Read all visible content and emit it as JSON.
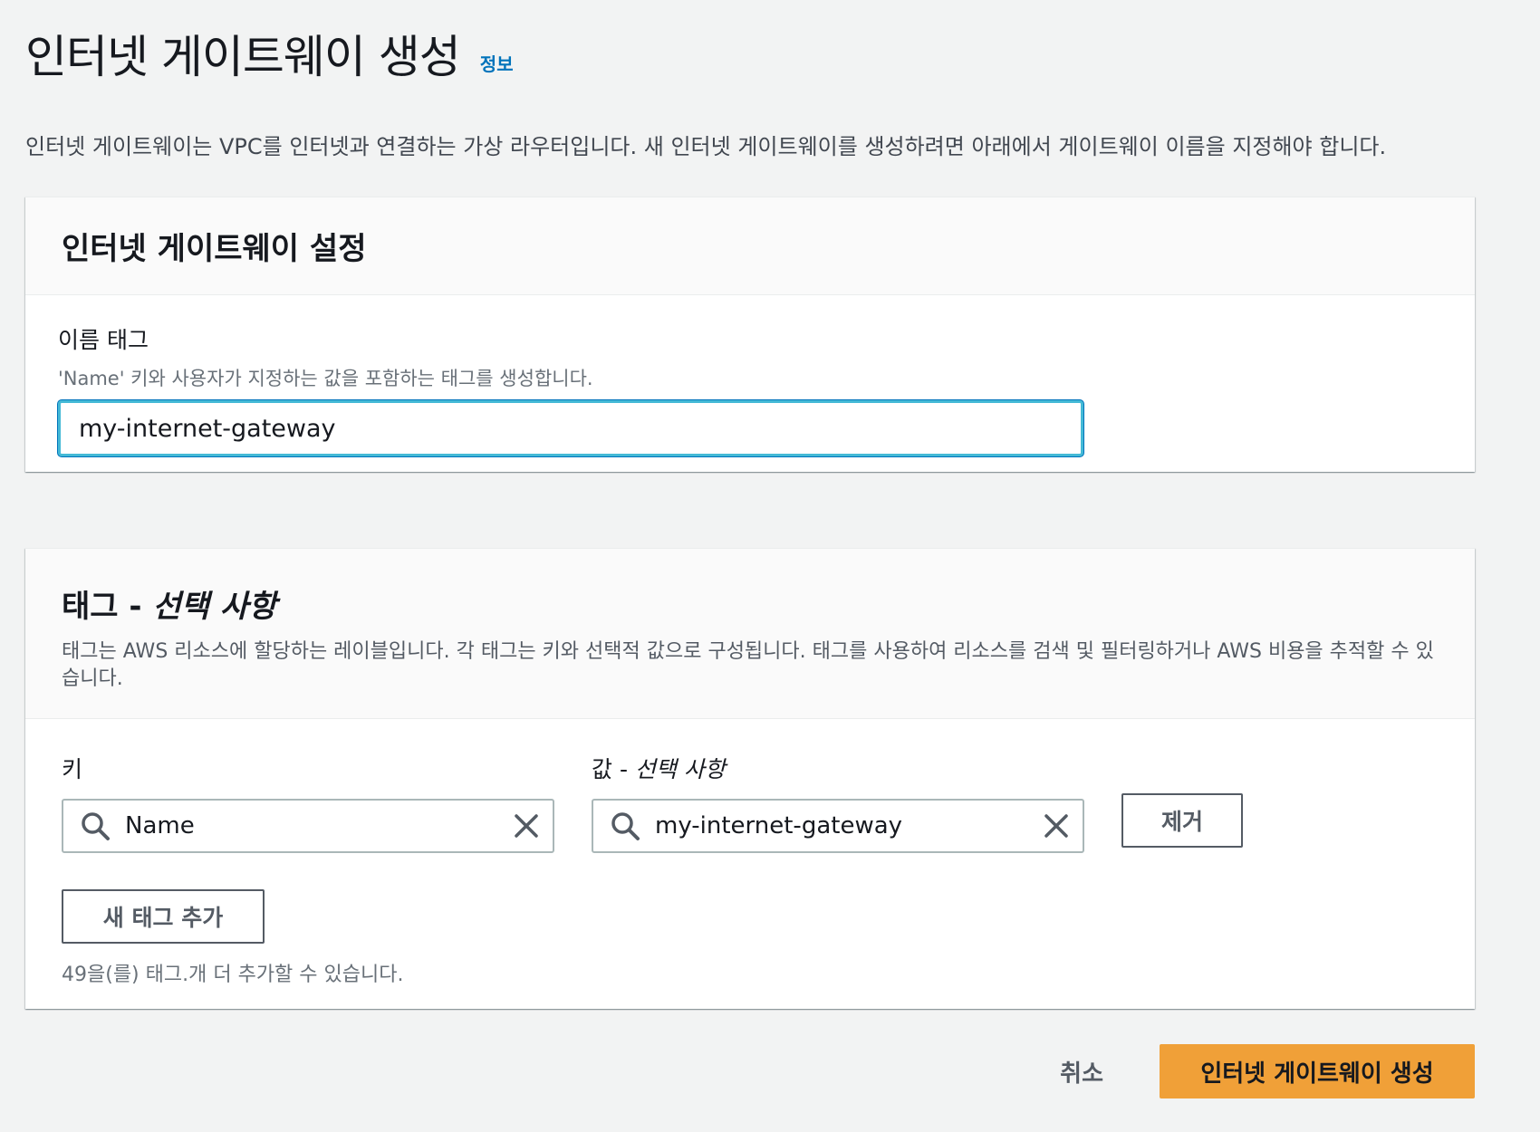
{
  "header": {
    "title": "인터넷 게이트웨이 생성",
    "info_link": "정보",
    "description": "인터넷 게이트웨이는 VPC를 인터넷과 연결하는 가상 라우터입니다. 새 인터넷 게이트웨이를 생성하려면 아래에서 게이트웨이 이름을 지정해야 합니다."
  },
  "settings": {
    "title": "인터넷 게이트웨이 설정",
    "name_tag_label": "이름 태그",
    "name_tag_description": "'Name' 키와 사용자가 지정하는 값을 포함하는 태그를 생성합니다.",
    "name_tag_value": "my-internet-gateway"
  },
  "tags": {
    "title_main": "태그 - ",
    "title_optional": "선택 사항",
    "description": "태그는 AWS 리소스에 할당하는 레이블입니다. 각 태그는 키와 선택적 값으로 구성됩니다. 태그를 사용하여 리소스를 검색 및 필터링하거나 AWS 비용을 추적할 수 있습니다.",
    "key_label": "키",
    "value_label_main": "값 - ",
    "value_label_optional": "선택 사항",
    "key_value": "Name",
    "value_value": "my-internet-gateway",
    "remove_button": "제거",
    "add_button": "새 태그 추가",
    "limit_text": "49을(를) 태그.개 더 추가할 수 있습니다."
  },
  "footer": {
    "cancel_button": "취소",
    "create_button": "인터넷 게이트웨이 생성"
  },
  "icons": {
    "search": "search-icon",
    "clear": "close-icon"
  },
  "colors": {
    "background": "#f2f3f3",
    "link": "#0073bb",
    "primary_button": "#f0a038",
    "focus_border": "#44b9d6"
  }
}
